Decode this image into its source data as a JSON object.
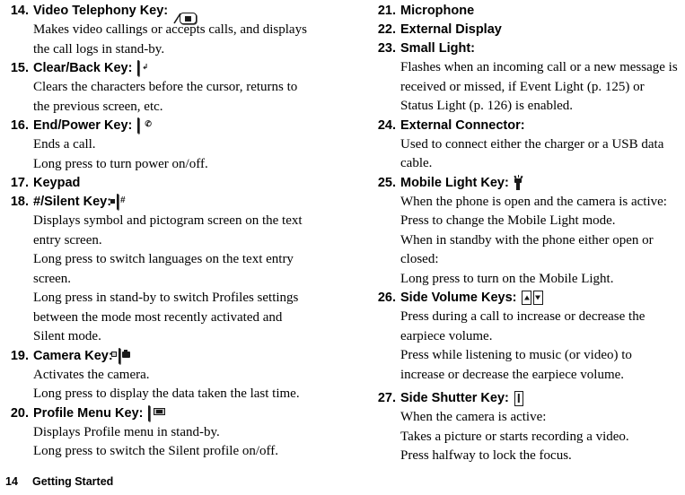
{
  "document": {
    "type": "mobile-phone-user-manual-page",
    "footer": {
      "page_number": "14",
      "section": "Getting Started"
    }
  },
  "left_column": {
    "items": [
      {
        "num": "14.",
        "title": "Video Telephony Key:",
        "icon": "video-telephony-key-icon",
        "lines": [
          "Makes video callings or accepts calls, and displays",
          "the call logs in stand-by."
        ]
      },
      {
        "num": "15.",
        "title": "Clear/Back Key:",
        "icon": "clear-back-key-icon",
        "lines": [
          "Clears the characters before the cursor, returns to",
          "the previous screen, etc."
        ]
      },
      {
        "num": "16.",
        "title": "End/Power Key:",
        "icon": "end-power-key-icon",
        "lines": [
          "Ends a call.",
          "Long press to turn power on/off."
        ]
      },
      {
        "num": "17.",
        "title": "Keypad",
        "icon": "",
        "lines": []
      },
      {
        "num": "18.",
        "title": "#/Silent Key:",
        "icon": "hash-silent-key-icon",
        "lines": [
          "Displays symbol and pictogram screen on the text",
          "entry screen.",
          "Long press to switch languages on the text entry",
          "screen.",
          "Long press in stand-by to switch Profiles settings",
          "between the mode most recently activated and",
          "Silent mode."
        ]
      },
      {
        "num": "19.",
        "title": "Camera Key:",
        "icon": "camera-key-icon",
        "lines": [
          "Activates the camera.",
          "Long press to display the data taken the last time."
        ]
      },
      {
        "num": "20.",
        "title": "Profile Menu Key:",
        "icon": "profile-menu-key-icon",
        "lines": [
          "Displays Profile menu in stand-by.",
          "Long press to switch the Silent profile on/off."
        ]
      }
    ]
  },
  "right_column": {
    "items": [
      {
        "num": "21.",
        "title": "Microphone",
        "icon": "",
        "lines": []
      },
      {
        "num": "22.",
        "title": "External Display",
        "icon": "",
        "lines": []
      },
      {
        "num": "23.",
        "title": "Small Light:",
        "icon": "",
        "lines": [
          "Flashes when an incoming call or a new message is",
          "received or missed, if Event Light (p. 125) or",
          "Status Light (p. 126) is enabled."
        ]
      },
      {
        "num": "24.",
        "title": "External Connector:",
        "icon": "",
        "lines": [
          "Used to connect either the charger or a USB data",
          "cable."
        ]
      },
      {
        "num": "25.",
        "title": "Mobile Light Key:",
        "icon": "mobile-light-key-icon",
        "lines": [
          "When the phone is open and the camera is active:",
          "Press to change the Mobile Light mode.",
          "When in standby with the phone either open or",
          "closed:",
          "Long press to turn on the Mobile Light."
        ]
      },
      {
        "num": "26.",
        "title": "Side Volume Keys:",
        "icon": "side-volume-keys-icon",
        "lines": [
          "Press during a call to increase or decrease the",
          "earpiece volume.",
          "Press while listening to music (or video) to",
          "increase or decrease the earpiece volume."
        ]
      },
      {
        "num": "27.",
        "title": "Side Shutter Key:",
        "icon": "side-shutter-key-icon",
        "lines": [
          "When the camera is active:",
          "Takes a picture or starts recording a video.",
          "Press halfway to lock the focus."
        ]
      }
    ]
  }
}
